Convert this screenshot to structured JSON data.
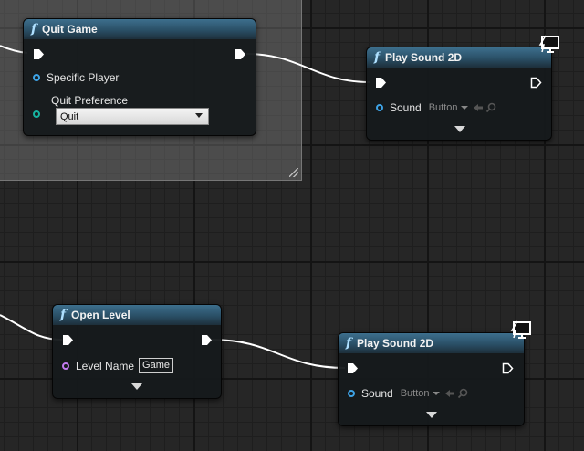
{
  "nodes": {
    "quit_game": {
      "title": "Quit Game",
      "pins": {
        "specific_player": "Specific Player",
        "quit_preference": "Quit Preference",
        "quit_preference_value": "Quit"
      }
    },
    "play_sound_top": {
      "title": "Play Sound 2D",
      "pins": {
        "sound": "Sound",
        "sound_value": "Button"
      }
    },
    "open_level": {
      "title": "Open Level",
      "pins": {
        "level_name": "Level Name",
        "level_name_value": "Game"
      }
    },
    "play_sound_bottom": {
      "title": "Play Sound 2D",
      "pins": {
        "sound": "Sound",
        "sound_value": "Button"
      }
    }
  },
  "icons": {
    "function": "f",
    "exec_pin": "exec-pin-icon",
    "dev_only": "monitor-icon",
    "asset_use": "arrow-left-icon",
    "asset_browse": "magnifier-icon"
  },
  "colors": {
    "function_header": "#3d6f8d",
    "object_pin": "#3ea3e6",
    "enum_pin": "#16b3a0",
    "name_pin": "#c37bf0",
    "exec_wire": "#ffffff"
  }
}
